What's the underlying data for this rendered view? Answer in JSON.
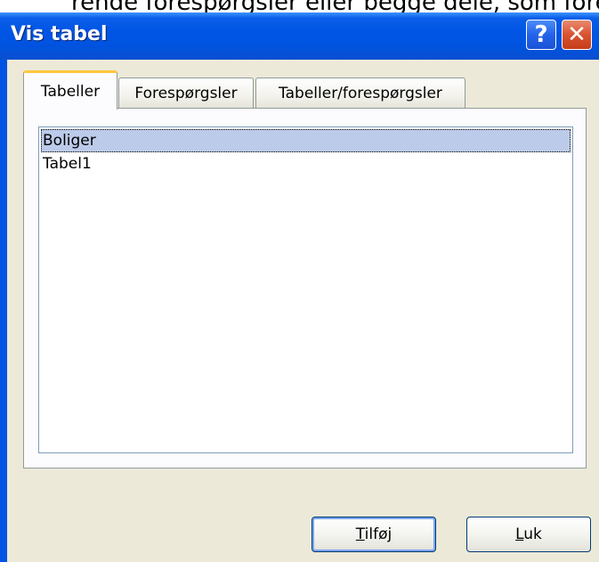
{
  "background": {
    "partial_text": "rende forespørgsler eller begge dele, som forespø"
  },
  "window": {
    "title": "Vis tabel",
    "help_label": "?",
    "close_label": "✕"
  },
  "tabs": [
    {
      "label": "Tabeller",
      "active": true
    },
    {
      "label": "Forespørgsler",
      "active": false
    },
    {
      "label": "Tabeller/forespørgsler",
      "active": false
    }
  ],
  "list": {
    "items": [
      {
        "label": "Boliger",
        "selected": true
      },
      {
        "label": "Tabel1",
        "selected": false
      }
    ]
  },
  "buttons": {
    "add_label": "Tilføj",
    "close_label": "Luk"
  },
  "colors": {
    "titlebar": "#0055e5",
    "client": "#ece9d8",
    "selection": "#bccbe9",
    "active_tab_accent": "#ffc73c"
  }
}
